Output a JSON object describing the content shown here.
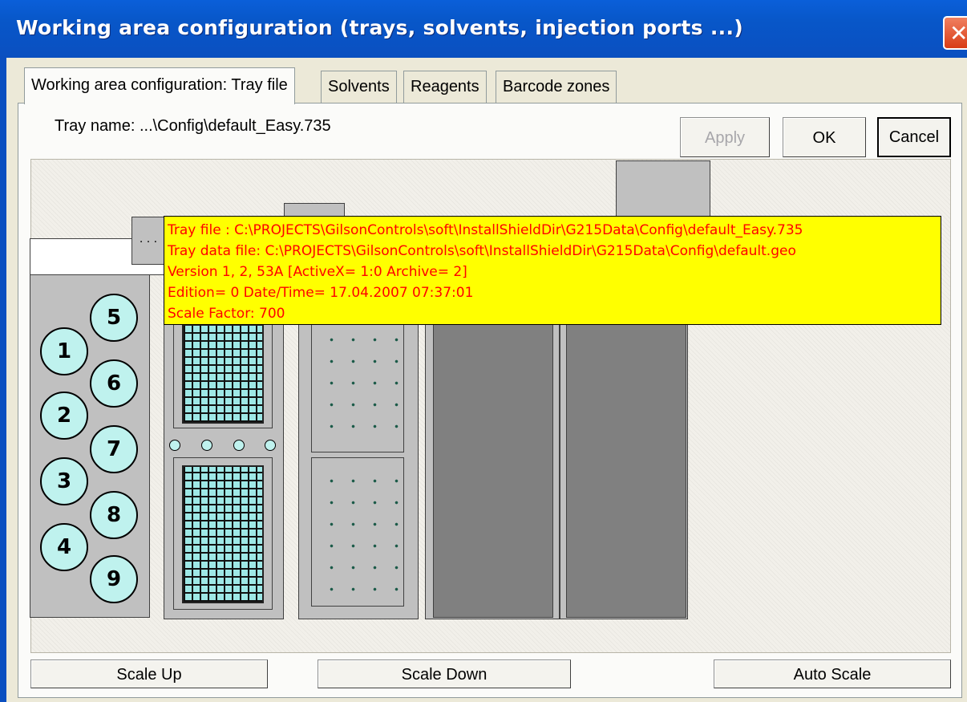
{
  "window": {
    "title": "Working area configuration (trays, solvents, injection ports ...)",
    "close_glyph": "✕"
  },
  "tabs": [
    {
      "label": "Working area configuration: Tray file",
      "active": true
    },
    {
      "label": "Solvents",
      "active": false
    },
    {
      "label": "Reagents",
      "active": false
    },
    {
      "label": "Barcode zones",
      "active": false
    }
  ],
  "tray_name": "Tray name: ...\\Config\\default_Easy.735",
  "buttons": {
    "apply": "Apply",
    "ok": "OK",
    "cancel": "Cancel",
    "scale_up": "Scale Up",
    "scale_down": "Scale Down",
    "auto_scale": "Auto Scale"
  },
  "small_tray_label": ". . .",
  "vials": [
    "1",
    "2",
    "3",
    "4",
    "5",
    "6",
    "7",
    "8",
    "9"
  ],
  "tooltip": {
    "lines": [
      "Tray file      :  C:\\PROJECTS\\GilsonControls\\soft\\InstallShieldDir\\G215Data\\Config\\default_Easy.735",
      "Tray data file:  C:\\PROJECTS\\GilsonControls\\soft\\InstallShieldDir\\G215Data\\Config\\default.geo",
      " Version 1, 2, 53A  [ActiveX= 1:0 Archive= 2]",
      " Edition= 0  Date/Time= 17.04.2007 07:37:01",
      "Scale Factor:  700"
    ],
    "background": "#ffff00",
    "text_color": "#ff0000"
  },
  "colors": {
    "titlebar": "#0a5fd9",
    "vial_fill": "#bff2ee",
    "rack_fill": "#9ee8e6"
  }
}
